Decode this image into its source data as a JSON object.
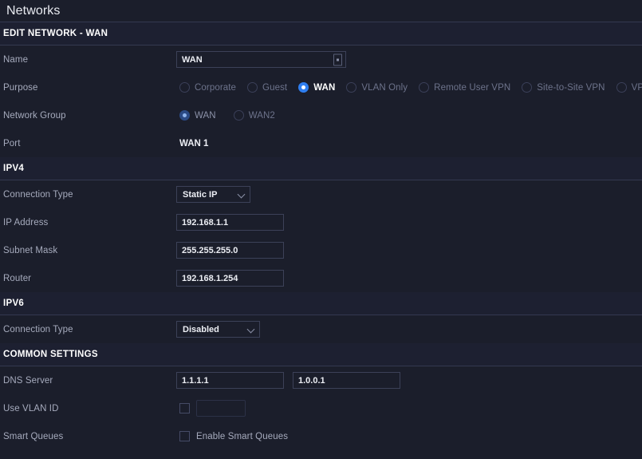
{
  "header": {
    "title": "Networks"
  },
  "edit_section": {
    "title": "EDIT NETWORK - WAN"
  },
  "fields": {
    "name": {
      "label": "Name",
      "value": "WAN",
      "stepper_icon": "stepper-icon"
    },
    "purpose": {
      "label": "Purpose",
      "options": [
        {
          "label": "Corporate",
          "selected": false
        },
        {
          "label": "Guest",
          "selected": false
        },
        {
          "label": "WAN",
          "selected": true
        },
        {
          "label": "VLAN Only",
          "selected": false
        },
        {
          "label": "Remote User VPN",
          "selected": false
        },
        {
          "label": "Site-to-Site VPN",
          "selected": false
        },
        {
          "label": "VPN Client",
          "selected": false
        }
      ]
    },
    "network_group": {
      "label": "Network Group",
      "options": [
        {
          "label": "WAN",
          "selected": true
        },
        {
          "label": "WAN2",
          "selected": false
        }
      ]
    },
    "port": {
      "label": "Port",
      "value": "WAN 1"
    }
  },
  "ipv4": {
    "title": "IPV4",
    "connection_type": {
      "label": "Connection Type",
      "value": "Static IP"
    },
    "ip_address": {
      "label": "IP Address",
      "value": "192.168.1.1"
    },
    "subnet_mask": {
      "label": "Subnet Mask",
      "value": "255.255.255.0"
    },
    "router": {
      "label": "Router",
      "value": "192.168.1.254"
    }
  },
  "ipv6": {
    "title": "IPV6",
    "connection_type": {
      "label": "Connection Type",
      "value": "Disabled"
    }
  },
  "common_settings": {
    "title": "COMMON SETTINGS",
    "dns_server": {
      "label": "DNS Server",
      "primary": "1.1.1.1",
      "secondary": "1.0.0.1"
    },
    "use_vlan_id": {
      "label": "Use VLAN ID",
      "checked": false,
      "value": ""
    },
    "smart_queues": {
      "label": "Smart Queues",
      "checkbox_label": "Enable Smart Queues",
      "checked": false
    }
  },
  "colors": {
    "background": "#1b1e2b",
    "panel": "#1d2031",
    "accent": "#2f7ef0",
    "divider": "#343950",
    "label_text": "#a6abbd",
    "value_text": "#eceef4",
    "muted_text": "#6d738b"
  }
}
